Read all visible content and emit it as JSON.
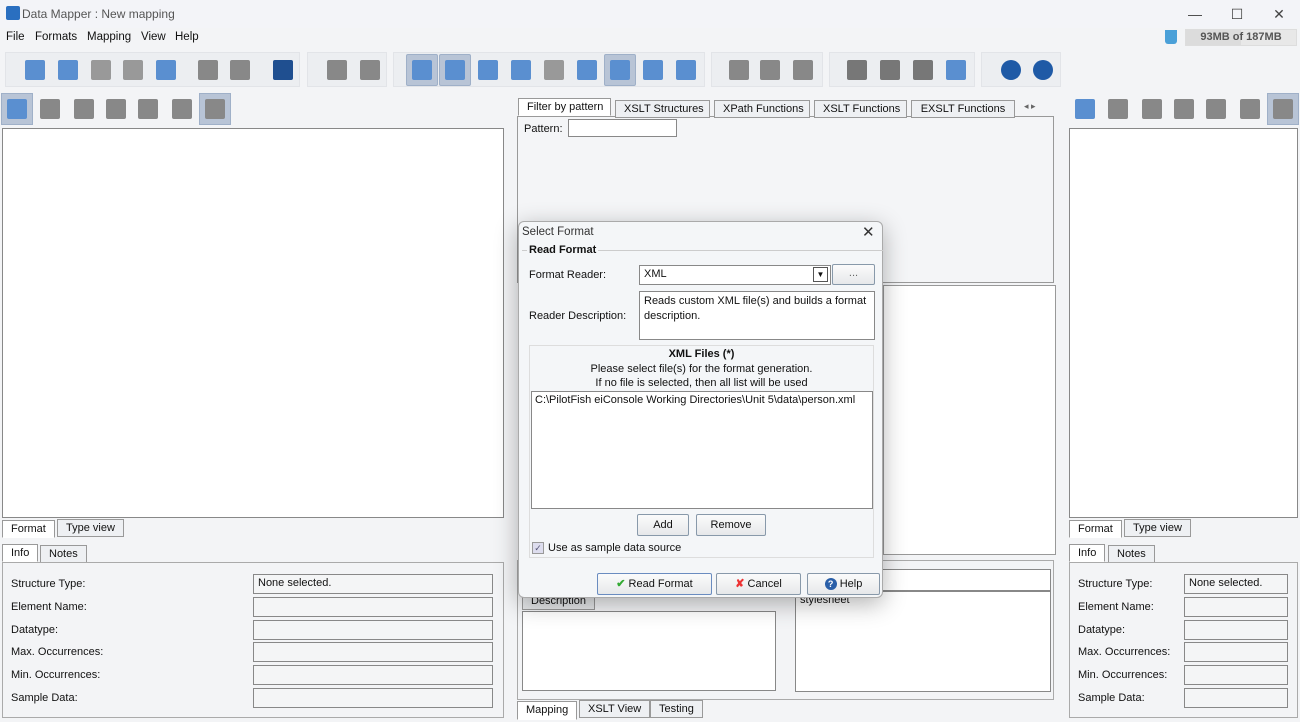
{
  "window": {
    "title": "Data Mapper : New mapping",
    "minimize": "—",
    "maximize": "☐",
    "close": "✕"
  },
  "menu": [
    "File",
    "Formats",
    "Mapping",
    "View",
    "Help"
  ],
  "memory": {
    "label": "93MB of 187MB",
    "used_fraction": 0.5
  },
  "toolbar_icons": [
    "new-format-icon",
    "open-icon",
    "save-disabled-icon",
    "save-as-icon",
    "new-xls-icon",
    "undo-icon",
    "redo-icon",
    "exit-icon",
    "db-add-icon",
    "db-settings-icon",
    "info-view-icon",
    "color-view-icon",
    "list-icon",
    "xslt-icon",
    "save-xslt-icon",
    "doc-icon",
    "xml-icon",
    "grid-icon",
    "database-icon",
    "cut-icon",
    "copy-icon",
    "paste-icon",
    "align-left-icon",
    "align-center-icon",
    "align-right-icon",
    "stack-icon",
    "help-icon",
    "about-icon"
  ],
  "left": {
    "bottom_tabs": [
      "Format",
      "Type view"
    ],
    "info_tabs": [
      "Info",
      "Notes"
    ],
    "props": [
      {
        "label": "Structure Type:",
        "value": "None selected."
      },
      {
        "label": "Element Name:",
        "value": ""
      },
      {
        "label": "Datatype:",
        "value": ""
      },
      {
        "label": "Max. Occurrences:",
        "value": ""
      },
      {
        "label": "Min. Occurrences:",
        "value": ""
      },
      {
        "label": "Sample Data:",
        "value": ""
      }
    ]
  },
  "right": {
    "bottom_tabs": [
      "Format",
      "Type view"
    ],
    "info_tabs": [
      "Info",
      "Notes"
    ],
    "props": [
      {
        "label": "Structure Type:",
        "value": "None selected."
      },
      {
        "label": "Element Name:",
        "value": ""
      },
      {
        "label": "Datatype:",
        "value": ""
      },
      {
        "label": "Max. Occurrences:",
        "value": ""
      },
      {
        "label": "Min. Occurrences:",
        "value": ""
      },
      {
        "label": "Sample Data:",
        "value": ""
      }
    ]
  },
  "center": {
    "tabs": [
      "Filter by pattern",
      "XSLT Structures",
      "XPath Functions",
      "XSLT Functions",
      "EXSLT Functions"
    ],
    "pattern_label": "Pattern:",
    "pattern_value": "",
    "description_tab": "Description",
    "stylesheet_text": "stylesheet",
    "bottom_tabs": [
      "Mapping",
      "XSLT View",
      "Testing"
    ]
  },
  "dialog": {
    "title": "Select Format",
    "group": "Read Format",
    "reader_label": "Format Reader:",
    "reader_value": "XML",
    "browse": "...",
    "desc_label": "Reader Description:",
    "desc_value": "Reads custom XML file(s) and builds a format description.",
    "files_title": "XML Files (*)",
    "files_hint1": "Please select file(s) for the format generation.",
    "files_hint2": "If no file is selected, then all list will be used",
    "files": [
      "C:\\PilotFish eiConsole Working Directories\\Unit 5\\data\\person.xml"
    ],
    "add": "Add",
    "remove": "Remove",
    "sample_label": "Use as sample data source",
    "sample_checked": true,
    "read": "Read Format",
    "cancel": "Cancel",
    "help": "Help"
  }
}
